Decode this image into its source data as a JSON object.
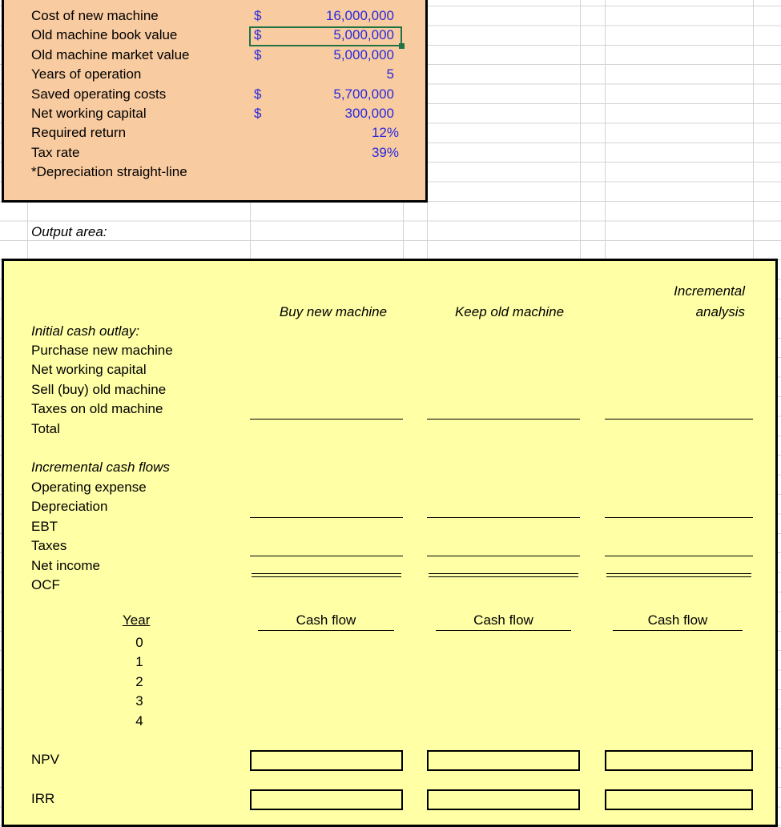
{
  "input_area": {
    "rows": [
      {
        "label": "Cost of new machine",
        "currency": "$",
        "value": "16,000,000"
      },
      {
        "label": "Old machine book value",
        "currency": "$",
        "value": "5,000,000"
      },
      {
        "label": "Old machine market value",
        "currency": "$",
        "value": "5,000,000"
      },
      {
        "label": "Years of operation",
        "currency": "",
        "value": "5"
      },
      {
        "label": "Saved operating costs",
        "currency": "$",
        "value": "5,700,000"
      },
      {
        "label": "Net working capital",
        "currency": "$",
        "value": "300,000"
      },
      {
        "label": "Required return",
        "currency": "",
        "value": "12%"
      },
      {
        "label": "Tax rate",
        "currency": "",
        "value": "39%"
      },
      {
        "label": "*Depreciation straight-line",
        "currency": "",
        "value": ""
      }
    ],
    "fill_color": "#F8CBA0"
  },
  "output_label": "Output area:",
  "output_area": {
    "fill_color": "#FFFFA6",
    "col_headers": [
      "Buy new machine",
      "Keep old machine"
    ],
    "incremental_header": [
      "Incremental",
      "analysis"
    ],
    "initial_heading": "Initial cash outlay:",
    "initial_rows": [
      "Purchase new machine",
      "Net working capital",
      "Sell (buy) old machine",
      "Taxes on old machine",
      "Total"
    ],
    "flows_heading": "Incremental cash flows",
    "flows_rows": [
      "Operating expense",
      "Depreciation",
      "EBT",
      "Taxes",
      "Net income",
      "OCF"
    ],
    "year_label": "Year",
    "years": [
      "0",
      "1",
      "2",
      "3",
      "4"
    ],
    "cash_flow_labels": [
      "Cash flow",
      "Cash flow",
      "Cash flow"
    ],
    "npv_label": "NPV",
    "irr_label": "IRR"
  }
}
